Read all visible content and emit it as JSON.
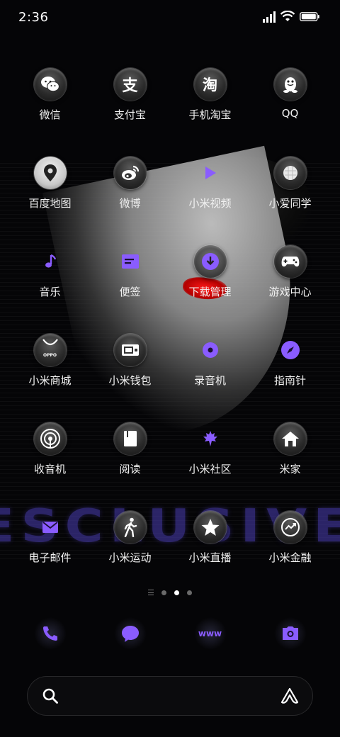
{
  "status_bar": {
    "time": "2:36"
  },
  "wallpaper": {
    "watermark_text": "ESCLUSIVE",
    "accent_color": "#8a5cff"
  },
  "apps": [
    {
      "label": "微信",
      "icon": "wechat-icon"
    },
    {
      "label": "支付宝",
      "icon": "alipay-icon",
      "glyph": "支"
    },
    {
      "label": "手机淘宝",
      "icon": "taobao-icon",
      "glyph": "淘"
    },
    {
      "label": "QQ",
      "icon": "qq-penguin-icon"
    },
    {
      "label": "百度地图",
      "icon": "map-pin-icon"
    },
    {
      "label": "微博",
      "icon": "weibo-icon"
    },
    {
      "label": "小米视频",
      "icon": "play-icon"
    },
    {
      "label": "小爱同学",
      "icon": "xiaoai-icon"
    },
    {
      "label": "音乐",
      "icon": "music-note-icon"
    },
    {
      "label": "便签",
      "icon": "notes-icon"
    },
    {
      "label": "下载管理",
      "icon": "download-icon"
    },
    {
      "label": "游戏中心",
      "icon": "gamepad-icon"
    },
    {
      "label": "小米商城",
      "icon": "oppo-store-icon",
      "glyph": "OPPO"
    },
    {
      "label": "小米钱包",
      "icon": "wallet-icon"
    },
    {
      "label": "录音机",
      "icon": "recorder-icon"
    },
    {
      "label": "指南针",
      "icon": "compass-icon"
    },
    {
      "label": "收音机",
      "icon": "radio-icon"
    },
    {
      "label": "阅读",
      "icon": "book-icon"
    },
    {
      "label": "小米社区",
      "icon": "maple-leaf-icon"
    },
    {
      "label": "米家",
      "icon": "home-icon"
    },
    {
      "label": "电子邮件",
      "icon": "mail-icon"
    },
    {
      "label": "小米运动",
      "icon": "walking-icon"
    },
    {
      "label": "小米直播",
      "icon": "star-icon"
    },
    {
      "label": "小米金融",
      "icon": "finance-chart-icon"
    }
  ],
  "page_indicator": {
    "pages": 3,
    "active": 2
  },
  "dock": [
    {
      "icon": "phone-icon"
    },
    {
      "icon": "message-icon"
    },
    {
      "icon": "browser-icon",
      "glyph": "www"
    },
    {
      "icon": "camera-icon"
    }
  ],
  "search": {
    "icon": "search-icon",
    "assistant_icon": "assistant-icon"
  }
}
